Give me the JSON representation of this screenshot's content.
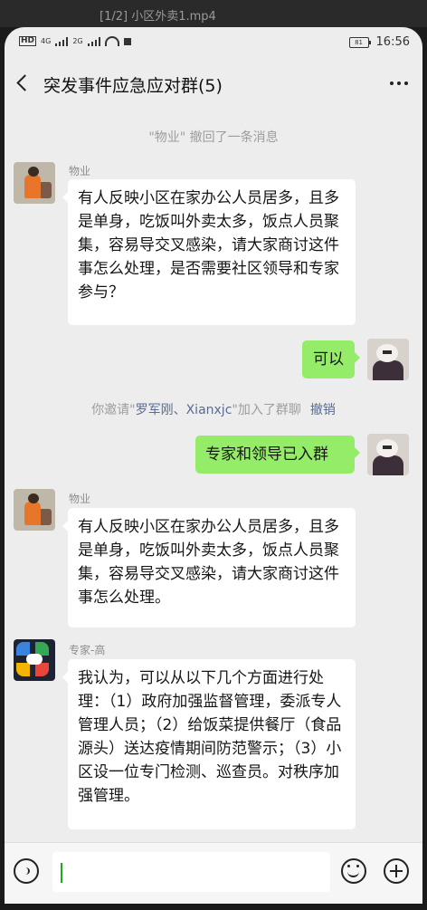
{
  "player": {
    "title": "[1/2] 小区外卖1.mp4"
  },
  "status_bar": {
    "net1": "HD",
    "net2": "4G",
    "net3": "2G",
    "battery": "81",
    "time": "16:56"
  },
  "header": {
    "title": "突发事件应急应对群(5)"
  },
  "messages": {
    "recall_notice": "\"物业\" 撤回了一条消息",
    "m1_sender": "物业",
    "m1_text": "有人反映小区在家办公人员居多，且多是单身，吃饭叫外卖太多，饭点人员聚集，容易导交叉感染，请大家商讨这件事怎么处理，是否需要社区领导和专家参与？",
    "m2_text": "可以",
    "invite_prefix": "你邀请\"",
    "invite_names": "罗军刚、Xianxjc",
    "invite_suffix": "\"加入了群聊",
    "invite_undo": "撤销",
    "m3_text": "专家和领导已入群",
    "m4_sender": "物业",
    "m4_text": "有人反映小区在家办公人员居多，且多是单身，吃饭叫外卖太多，饭点人员聚集，容易导交叉感染，请大家商讨这件事怎么处理。",
    "m5_sender": "专家-高",
    "m5_text": "我认为，可以从以下几个方面进行处理：（1）政府加强监督管理，委派专人管理人员；（2）给饭菜提供餐厅（食品源头）送达疫情期间防范警示；（3）小区设一位专门检测、巡查员。对秩序加强管理。"
  },
  "icons": {
    "back": "chevron-left-icon",
    "more": "more-icon",
    "voice": "voice-icon",
    "emoji": "emoji-icon",
    "plus": "plus-icon"
  },
  "colors": {
    "background": "#ededed",
    "sent_bubble": "#95ec69",
    "link": "#576b95"
  }
}
